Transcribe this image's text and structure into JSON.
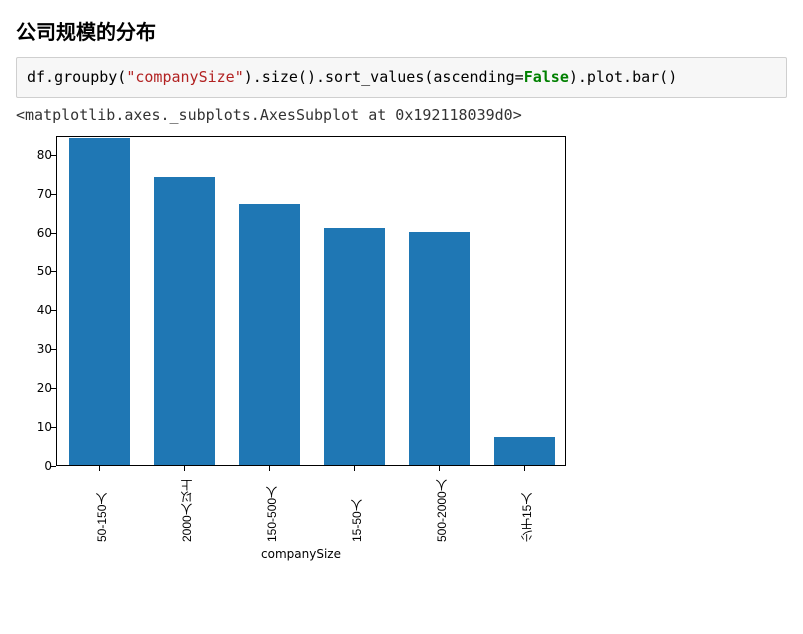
{
  "heading": "公司规模的分布",
  "code": {
    "pre_str": "df.groupby(",
    "str": "\"companySize\"",
    "mid1": ").size().sort_values(ascending=",
    "const": "False",
    "post": ").plot.bar()"
  },
  "output_repr": "<matplotlib.axes._subplots.AxesSubplot at 0x192118039d0>",
  "chart_data": {
    "type": "bar",
    "title": "",
    "xlabel": "companySize",
    "ylabel": "",
    "ylim": [
      0,
      85
    ],
    "yticks": [
      0,
      10,
      20,
      30,
      40,
      50,
      60,
      70,
      80
    ],
    "categories": [
      "50-150人",
      "2000人以上",
      "150-500人",
      "15-50人",
      "500-2000人",
      "少于15人"
    ],
    "values": [
      84,
      74,
      67,
      61,
      60,
      7
    ]
  },
  "colors": {
    "bar": "#1f77b4"
  }
}
